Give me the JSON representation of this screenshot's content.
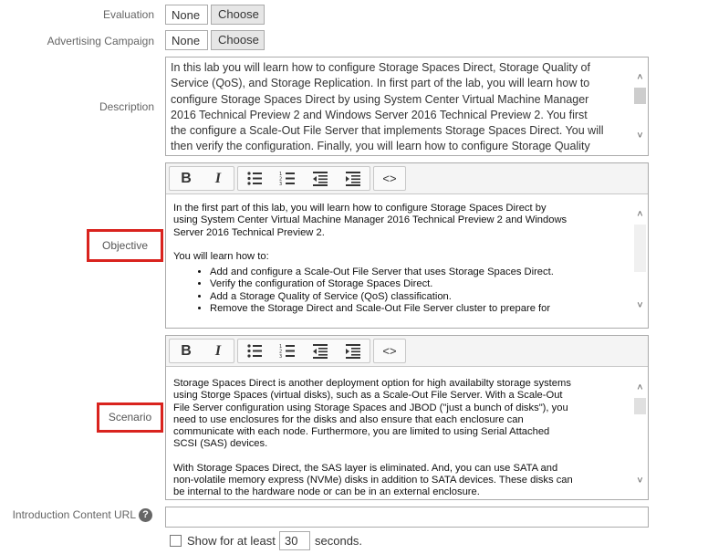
{
  "evaluation": {
    "label": "Evaluation",
    "value": "None",
    "choose": "Choose"
  },
  "advertising": {
    "label": "Advertising Campaign",
    "value": "None",
    "choose": "Choose"
  },
  "description": {
    "label": "Description",
    "lines": [
      "In this lab you will learn how to configure Storage Spaces Direct, Storage Quality of",
      "Service (QoS),  and Storage Replication. In first part of the lab, you will learn how to",
      "configure Storage Spaces Direct by using System Center Virtual Machine Manager",
      "2016 Technical Preview 2 and Windows Server 2016 Technical Preview 2.  You first",
      "the configure a Scale-Out File Server that implements Storage Spaces Direct. You will",
      "then verify the configuration. Finally, you will learn how to configure Storage Quality"
    ]
  },
  "toolbar": {
    "bold": "B",
    "italic": "I",
    "html": "<>"
  },
  "objective": {
    "label": "Objective",
    "lines": [
      "In the first part of this lab, you will learn how to configure Storage Spaces Direct by",
      "using System Center Virtual Machine Manager 2016 Technical Preview 2 and Windows",
      "Server 2016 Technical Preview 2."
    ],
    "intro": "You will learn how to:",
    "bullets": [
      "Add and configure a Scale-Out File Server that uses Storage Spaces Direct.",
      "Verify the configuration of Storage Spaces Direct.",
      "Add a Storage Quality of Service (QoS) classification.",
      "Remove the Storage Direct and Scale-Out File Server cluster to prepare for"
    ]
  },
  "scenario": {
    "label": "Scenario",
    "para1": [
      "Storage Spaces Direct is another deployment option for high availabilty storage systems",
      "using Storge Spaces (virtual disks), such as a Scale-Out File Server. With a Scale-Out",
      "File Server configuration using Storage Spaces and JBOD (\"just a bunch of disks\"), you",
      "need to use enclosures for the disks and also ensure that each enclosure can",
      "communicate with each node. Furthermore, you are limited to using Serial Attached",
      "SCSI (SAS) devices."
    ],
    "para2": [
      "With Storage Spaces Direct, the SAS layer is eliminated. And, you can use SATA and",
      "non-volatile memory express (NVMe) disks in addition to SATA devices. These disks can",
      "be internal to the hardware node or can be in an external enclosure."
    ]
  },
  "intro_url": {
    "label": "Introduction Content URL",
    "help": "?",
    "value": ""
  },
  "show_for": {
    "prefix": "Show for at least",
    "value": "30",
    "suffix": "seconds."
  },
  "colors": {
    "highlight_border": "#d9231e",
    "border": "#aaaaaa",
    "toolbar_bg": "#f4f4f4"
  },
  "icons": [
    "bold-icon",
    "italic-icon",
    "bullet-list-icon",
    "numbered-list-icon",
    "outdent-icon",
    "indent-icon",
    "code-icon",
    "help-icon",
    "scroll-up-icon",
    "scroll-down-icon"
  ]
}
